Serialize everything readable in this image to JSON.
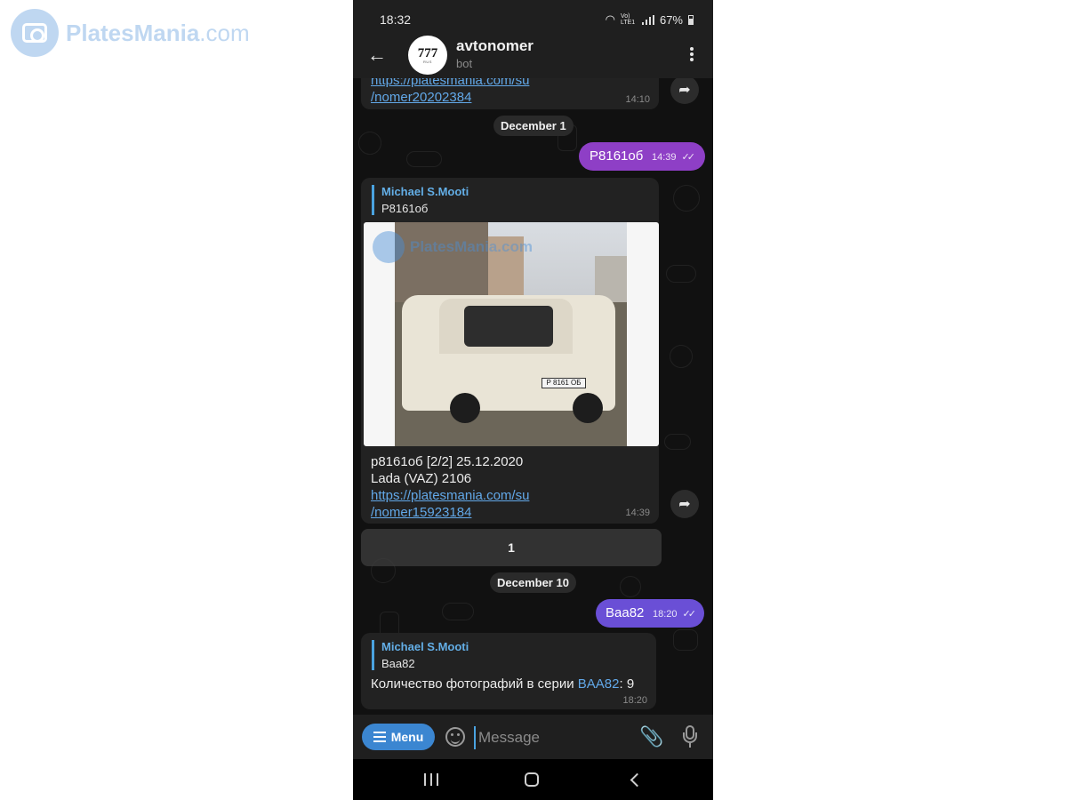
{
  "watermark": {
    "brand_bold": "Plates",
    "brand_blue": "Mania",
    "brand_suffix": ".com"
  },
  "status_bar": {
    "time": "18:32",
    "network": "Vo) LTE1",
    "battery": "67%"
  },
  "header": {
    "title": "avtonomer",
    "subtitle": "bot",
    "avatar_text": "777",
    "avatar_sub": "RUS"
  },
  "messages": {
    "first": {
      "link_line1": "https://platesmania.com/su",
      "link_line2": "/nomer20202384",
      "time": "14:10"
    },
    "date1": "December 1",
    "out1": {
      "text": "Р8161об",
      "time": "14:39"
    },
    "reply1": {
      "reply_name": "Michael S.Mooti",
      "reply_text": "Р8161об",
      "photo_watermark": "PlatesMania.com",
      "photo_plate": "Р 8161 ОБ",
      "caption_line1": "р8161об [2/2] 25.12.2020",
      "caption_line2": "Lada (VAZ) 2106",
      "link_line1": "https://platesmania.com/su",
      "link_line2": "/nomer15923184",
      "time": "14:39"
    },
    "inline_button": "1",
    "date2": "December 10",
    "out2": {
      "text": "Baa82",
      "time": "18:20"
    },
    "reply2": {
      "reply_name": "Michael S.Mooti",
      "reply_text": "Baa82",
      "body_prefix": "Количество фотографий в серии ",
      "body_link": "BAA82",
      "body_suffix": ": 9",
      "time": "18:20"
    }
  },
  "input_bar": {
    "menu_label": "Menu",
    "placeholder": "Message"
  },
  "colors": {
    "accent": "#3b86d1",
    "link": "#62a8e8",
    "out_bubble1": "#8e3fc6",
    "out_bubble2": "#6a4fd6",
    "bubble_in": "#222222"
  }
}
